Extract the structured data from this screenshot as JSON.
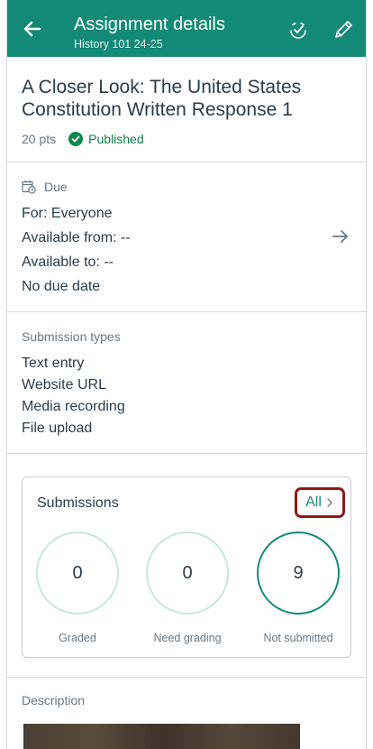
{
  "header": {
    "title": "Assignment details",
    "subtitle": "History 101 24-25",
    "background_color": "#138a75",
    "back_icon": "arrow-left-icon",
    "publish_icon": "publish-check-icon",
    "edit_icon": "pencil-icon"
  },
  "assignment": {
    "title": "A Closer Look: The United States Constitution Written Response 1",
    "points": "20 pts",
    "status": "Published",
    "status_color": "#0b874b"
  },
  "due": {
    "label": "Due",
    "for": "For:  Everyone",
    "available_from": "Available from:  --",
    "available_to": "Available to:  --",
    "due_date": "No due date",
    "arrow_icon": "arrow-right-icon"
  },
  "submission_types": {
    "label": "Submission types",
    "items": [
      "Text entry",
      "Website URL",
      "Media recording",
      "File upload"
    ]
  },
  "submissions": {
    "title": "Submissions",
    "all_label": "All",
    "highlight_color": "#8b1a1a",
    "stats": [
      {
        "value": "0",
        "label": "Graded"
      },
      {
        "value": "0",
        "label": "Need grading"
      },
      {
        "value": "9",
        "label": "Not submitted"
      }
    ]
  },
  "description": {
    "label": "Description"
  }
}
